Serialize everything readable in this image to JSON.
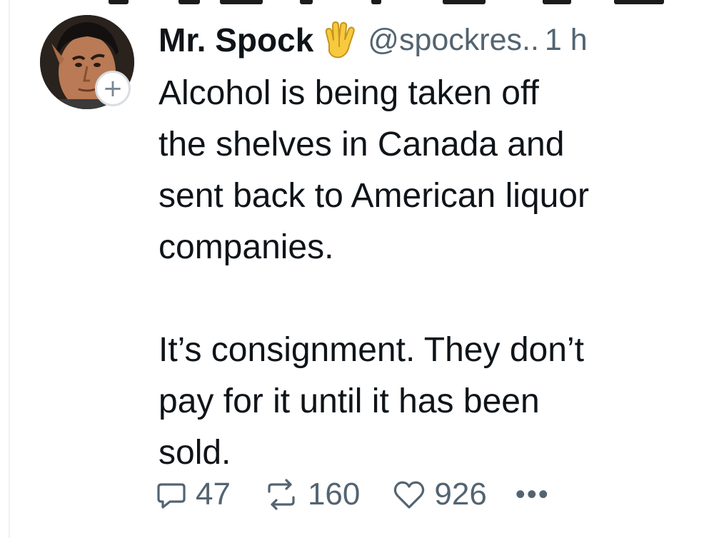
{
  "post": {
    "author": {
      "display_name": "Mr. Spock",
      "handle": "@spockres..",
      "badge_icon": "vulcan-salute-icon",
      "follow_label": "+"
    },
    "time": "1 h",
    "text": {
      "paragraph_1": "Alcohol is being taken off\nthe shelves in Canada and\nsent back to American liquor\ncompanies.",
      "paragraph_2": "It’s consignment. They don’t\npay for it until it has been\nsold."
    },
    "stats": {
      "replies": "47",
      "reposts": "160",
      "likes": "926"
    },
    "more_label": "•••"
  },
  "colors": {
    "text_primary": "#0f1419",
    "text_secondary": "#536471",
    "badge_border": "#d9dde1"
  }
}
